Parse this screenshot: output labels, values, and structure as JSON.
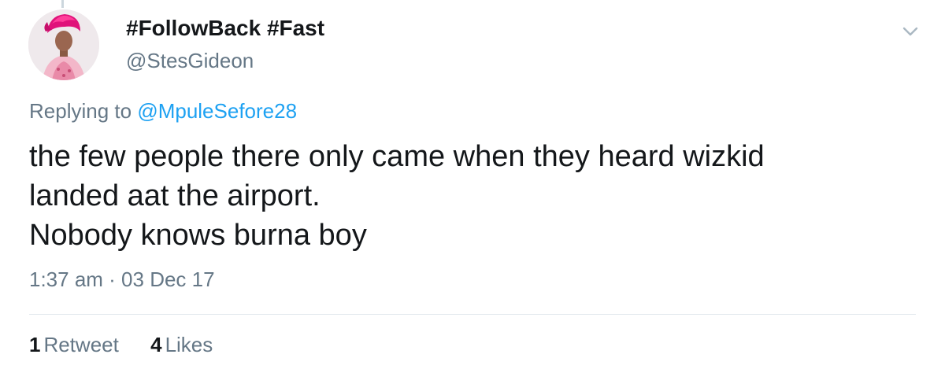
{
  "tweet": {
    "display_name": "#FollowBack #Fast",
    "handle": "@StesGideon",
    "reply_prefix": "Replying to",
    "reply_to": "@MpuleSefore28",
    "text_lines": [
      "the few people there only came when they heard wizkid",
      "landed aat the airport.",
      "Nobody knows burna boy"
    ],
    "timestamp": "1:37 am · 03 Dec 17",
    "retweets": {
      "count": "1",
      "label": "Retweet"
    },
    "likes": {
      "count": "4",
      "label": "Likes"
    }
  },
  "icons": {
    "menu": "chevron-down-icon",
    "avatar": "profile-photo"
  },
  "colors": {
    "text": "#14171a",
    "secondary": "#657786",
    "link": "#1da1f2",
    "divider": "#e1e8ed"
  }
}
